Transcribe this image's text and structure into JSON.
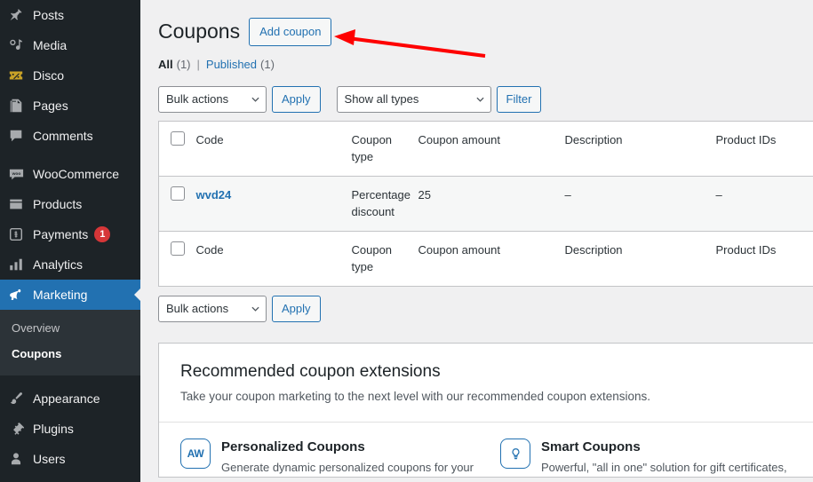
{
  "sidebar": {
    "items": [
      {
        "label": "Posts",
        "icon": "pin-icon",
        "current": false
      },
      {
        "label": "Media",
        "icon": "media-icon",
        "current": false
      },
      {
        "label": "Disco",
        "icon": "ticket-icon",
        "current": false
      },
      {
        "label": "Pages",
        "icon": "pages-icon",
        "current": false
      },
      {
        "label": "Comments",
        "icon": "comment-icon",
        "current": false
      },
      {
        "label": "WooCommerce",
        "icon": "woocommerce-icon",
        "current": false
      },
      {
        "label": "Products",
        "icon": "products-icon",
        "current": false
      },
      {
        "label": "Payments",
        "icon": "payments-icon",
        "current": false,
        "badge": "1"
      },
      {
        "label": "Analytics",
        "icon": "chart-bar-icon",
        "current": false
      },
      {
        "label": "Marketing",
        "icon": "megaphone-icon",
        "current": true
      },
      {
        "label": "Appearance",
        "icon": "paintbrush-icon",
        "current": false
      },
      {
        "label": "Plugins",
        "icon": "plug-icon",
        "current": false
      },
      {
        "label": "Users",
        "icon": "user-icon",
        "current": false
      }
    ],
    "submenu": {
      "items": [
        {
          "label": "Overview",
          "current": false
        },
        {
          "label": "Coupons",
          "current": true
        }
      ]
    },
    "accent_color": "#2271b1",
    "background_color": "#1d2327",
    "badge_color": "#d63638"
  },
  "header": {
    "title": "Coupons",
    "add_button_label": "Add coupon"
  },
  "status_links": {
    "all_label": "All",
    "all_count": "(1)",
    "separator": "|",
    "published_label": "Published",
    "published_count": "(1)"
  },
  "tablenav_top": {
    "bulk_actions_label": "Bulk actions",
    "apply_label": "Apply",
    "type_filter_label": "Show all types",
    "filter_label": "Filter"
  },
  "tablenav_bottom": {
    "bulk_actions_label": "Bulk actions",
    "apply_label": "Apply"
  },
  "table": {
    "columns": [
      "Code",
      "Coupon type",
      "Coupon amount",
      "Description",
      "Product IDs"
    ],
    "rows": [
      {
        "code": "wvd24",
        "coupon_type": "Percentage discount",
        "coupon_amount": "25",
        "description": "–",
        "product_ids": "–"
      }
    ]
  },
  "recommendations": {
    "title": "Recommended coupon extensions",
    "subtitle": "Take your coupon marketing to the next level with our recommended coupon extensions.",
    "extensions": [
      {
        "icon_text": "AW",
        "icon_name": "automatewoo-icon",
        "name": "Personalized Coupons",
        "description": "Generate dynamic personalized coupons for your"
      },
      {
        "icon_text": "",
        "icon_name": "lightbulb-icon",
        "name": "Smart Coupons",
        "description": "Powerful, \"all in one\" solution for gift certificates,"
      }
    ]
  },
  "annotation": {
    "arrow_color": "#fe0000",
    "points_to": "Add coupon"
  }
}
